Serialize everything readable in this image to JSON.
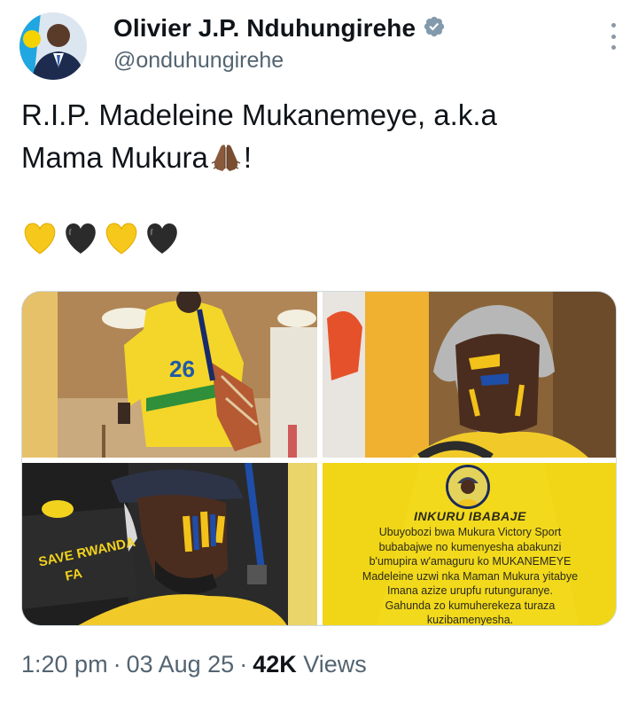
{
  "author": {
    "display_name": "Olivier J.P. Nduhungirehe",
    "handle": "@onduhungirehe",
    "verified": true,
    "icons": {
      "verified": "verified-badge-icon",
      "more": "more-options-icon"
    }
  },
  "tweet": {
    "text_line1": "R.I.P. Madeleine Mukanemeye, a.k.a",
    "text_line2": "Mama Mukura",
    "text_line2_end": "!",
    "emoji": {
      "pray": "folded-hands-emoji",
      "hearts": [
        "yellow-heart",
        "black-heart",
        "yellow-heart",
        "black-heart"
      ]
    }
  },
  "media": {
    "photo4": {
      "title": "INKURU IBABAJE",
      "lines": [
        "Ubuyobozi bwa Mukura Victory Sport",
        "bubabajwe no kumenyesha abakunzi",
        "b'umupira w'amaguru ko MUKANEMEYE",
        "Madeleine uzwi nka Maman Mukura yitabye",
        "Imana azize urupfu rutunguranye.",
        "Gahunda zo kumuherekeza turaza",
        "kuzibamenyesha."
      ]
    },
    "photo1": {
      "jersey_number": "26"
    },
    "photo3": {
      "banner_text": "SAVE RWANDA",
      "banner_text2": "FA"
    }
  },
  "meta": {
    "time": "1:20 pm",
    "date": "03 Aug 25",
    "views_count": "42K",
    "views_label": "Views",
    "separator": "·"
  },
  "colors": {
    "text_primary": "#0f1419",
    "text_secondary": "#536471",
    "verified_blue": "#1d9bf0",
    "mukura_yellow": "#f2d91c"
  }
}
